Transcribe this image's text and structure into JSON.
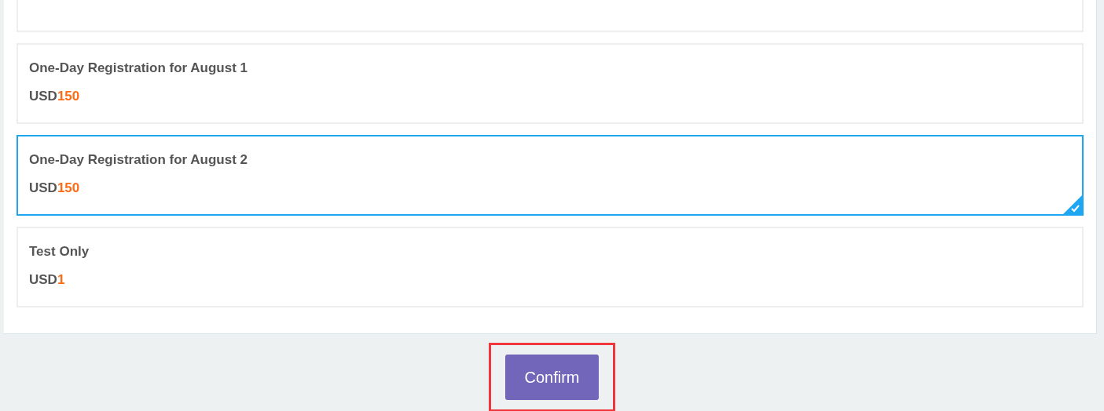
{
  "options": [
    {
      "title": "One-Day Registration for August 1",
      "currency": "USD",
      "price": "150",
      "selected": false
    },
    {
      "title": "One-Day Registration for August 2",
      "currency": "USD",
      "price": "150",
      "selected": true
    },
    {
      "title": "Test Only",
      "currency": "USD",
      "price": "1",
      "selected": false
    }
  ],
  "confirm_button": {
    "label": "Confirm",
    "highlighted": true
  }
}
